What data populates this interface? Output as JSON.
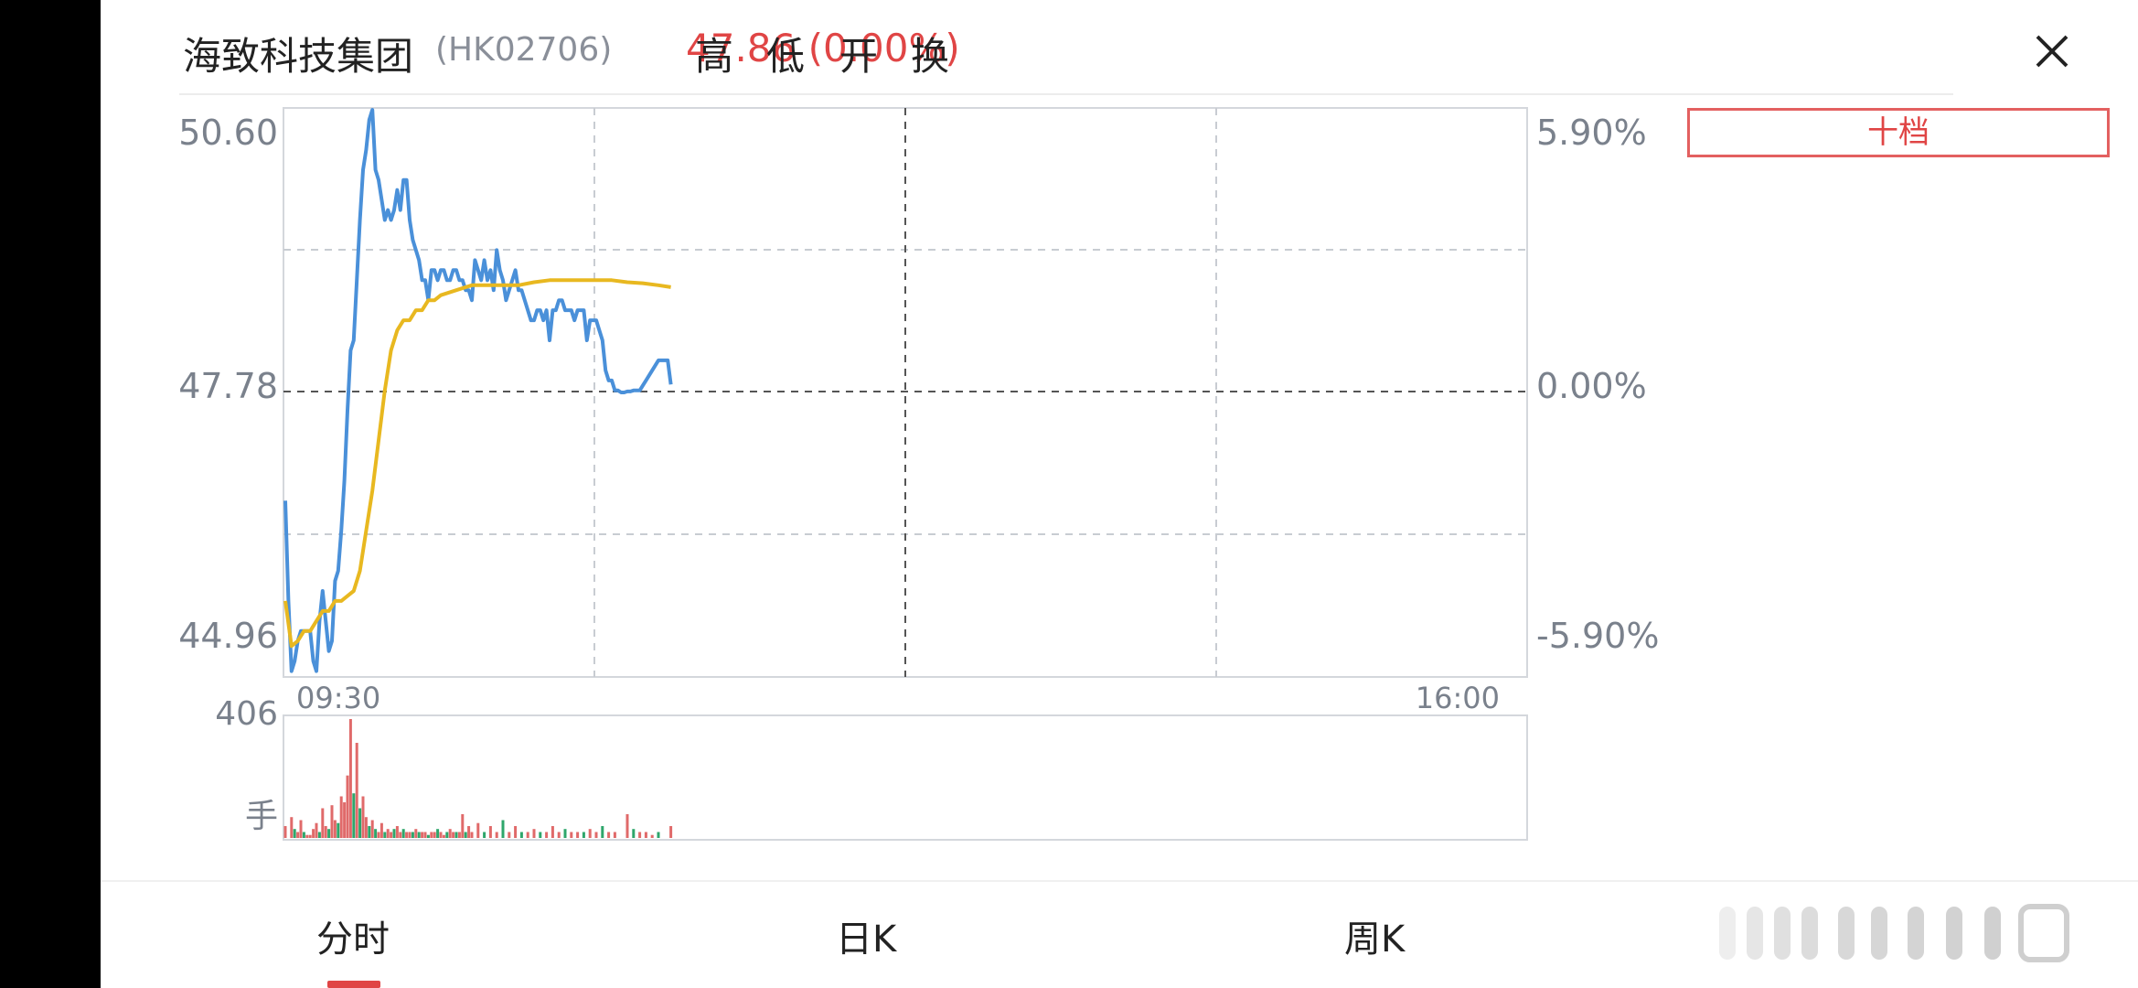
{
  "header": {
    "name": "海致科技集团",
    "code": "(HK02706)",
    "price_text": "47.86 (0.00%)",
    "buttons": [
      "高",
      "低",
      "开",
      "换"
    ]
  },
  "ten_level_label": "十档",
  "chart_data": {
    "type": "line",
    "title": "",
    "price_axis": {
      "min": 44.96,
      "mid": 47.78,
      "max": 50.6,
      "labels": [
        "50.60",
        "47.78",
        "44.96"
      ]
    },
    "pct_axis": {
      "labels": [
        "5.90%",
        "0.00%",
        "-5.90%"
      ]
    },
    "time_labels": [
      "09:30",
      "16:00"
    ],
    "volume_axis": {
      "max_label": "406",
      "unit_label": "手"
    },
    "series": [
      {
        "color": "#4a90d9",
        "x": [
          0,
          1,
          2,
          3,
          4,
          5,
          6,
          7,
          8,
          9,
          10,
          11,
          12,
          13,
          14,
          15,
          16,
          17,
          18,
          19,
          20,
          21,
          22,
          23,
          24,
          25,
          26,
          27,
          28,
          29,
          30,
          31,
          32,
          33,
          34,
          35,
          36,
          37,
          38,
          39,
          40,
          41,
          42,
          43,
          44,
          45,
          46,
          47,
          48,
          49,
          50,
          51,
          52,
          53,
          54,
          55,
          56,
          57,
          58,
          59,
          60,
          61,
          62,
          63,
          64,
          65,
          66,
          67,
          68,
          69,
          70,
          71,
          72,
          73,
          74,
          75,
          76,
          77,
          78,
          79,
          80,
          81,
          82,
          83,
          84,
          85,
          86,
          87,
          88,
          89,
          90,
          91,
          92,
          93,
          94,
          95,
          96,
          97,
          98,
          99,
          100,
          101,
          102,
          103,
          104,
          105,
          106,
          107,
          108,
          109,
          110,
          111,
          112,
          113,
          114,
          115,
          116,
          117,
          118,
          119,
          120,
          121,
          122,
          123,
          124
        ],
        "values": [
          46.7,
          45.7,
          45.0,
          45.1,
          45.3,
          45.4,
          45.4,
          45.4,
          45.4,
          45.1,
          45.0,
          45.5,
          45.8,
          45.5,
          45.2,
          45.3,
          45.9,
          46.0,
          46.4,
          46.9,
          47.6,
          48.2,
          48.3,
          48.9,
          49.5,
          50.0,
          50.2,
          50.5,
          50.6,
          50.0,
          49.9,
          49.7,
          49.5,
          49.6,
          49.5,
          49.6,
          49.8,
          49.6,
          49.9,
          49.9,
          49.5,
          49.3,
          49.2,
          49.1,
          48.9,
          48.9,
          48.7,
          49.0,
          49.0,
          48.9,
          49.0,
          49.0,
          48.9,
          48.9,
          49.0,
          49.0,
          48.9,
          48.9,
          48.8,
          48.8,
          48.7,
          49.1,
          49.0,
          48.9,
          49.1,
          48.9,
          49.0,
          48.8,
          49.2,
          49.0,
          48.9,
          48.7,
          48.8,
          48.9,
          49.0,
          48.8,
          48.8,
          48.7,
          48.6,
          48.5,
          48.5,
          48.6,
          48.6,
          48.5,
          48.6,
          48.3,
          48.6,
          48.6,
          48.7,
          48.7,
          48.6,
          48.6,
          48.6,
          48.5,
          48.6,
          48.6,
          48.6,
          48.3,
          48.5,
          48.5,
          48.5,
          48.4,
          48.3,
          48.0,
          47.9,
          47.9,
          47.8,
          47.8,
          47.78,
          47.78,
          47.79,
          47.79,
          47.8,
          47.8,
          47.8,
          47.85,
          47.9,
          47.95,
          48.0,
          48.05,
          48.1,
          48.1,
          48.1,
          48.1,
          47.86
        ]
      },
      {
        "color": "#e8b820",
        "x": [
          0,
          2,
          4,
          6,
          8,
          10,
          12,
          14,
          16,
          18,
          20,
          22,
          24,
          26,
          28,
          30,
          32,
          34,
          36,
          38,
          40,
          42,
          44,
          46,
          48,
          50,
          55,
          60,
          65,
          70,
          75,
          80,
          85,
          90,
          95,
          100,
          105,
          110,
          115,
          120,
          124
        ],
        "values": [
          45.7,
          45.25,
          45.3,
          45.4,
          45.4,
          45.5,
          45.6,
          45.6,
          45.7,
          45.7,
          45.75,
          45.8,
          46.0,
          46.4,
          46.8,
          47.3,
          47.8,
          48.2,
          48.4,
          48.5,
          48.5,
          48.6,
          48.6,
          48.7,
          48.7,
          48.75,
          48.8,
          48.85,
          48.85,
          48.85,
          48.85,
          48.88,
          48.9,
          48.9,
          48.9,
          48.9,
          48.9,
          48.88,
          48.87,
          48.85,
          48.83
        ]
      }
    ],
    "volume": {
      "x": [
        0,
        2,
        3,
        4,
        5,
        6,
        7,
        8,
        9,
        10,
        11,
        12,
        13,
        14,
        15,
        16,
        17,
        18,
        19,
        20,
        21,
        22,
        23,
        24,
        25,
        26,
        27,
        28,
        29,
        30,
        31,
        32,
        33,
        34,
        35,
        36,
        37,
        38,
        39,
        40,
        41,
        42,
        43,
        44,
        45,
        46,
        47,
        48,
        49,
        50,
        51,
        52,
        53,
        54,
        55,
        56,
        57,
        58,
        59,
        60,
        62,
        64,
        66,
        68,
        70,
        72,
        74,
        76,
        78,
        80,
        82,
        84,
        86,
        88,
        90,
        92,
        94,
        96,
        98,
        100,
        102,
        104,
        106,
        110,
        112,
        114,
        116,
        118,
        120,
        124
      ],
      "values": [
        40,
        70,
        30,
        20,
        60,
        20,
        10,
        10,
        30,
        50,
        20,
        100,
        40,
        30,
        110,
        60,
        50,
        140,
        120,
        210,
        400,
        150,
        320,
        100,
        140,
        70,
        40,
        60,
        30,
        20,
        50,
        20,
        30,
        20,
        30,
        40,
        20,
        30,
        20,
        20,
        20,
        30,
        20,
        20,
        20,
        10,
        20,
        20,
        30,
        20,
        10,
        20,
        30,
        20,
        20,
        20,
        80,
        20,
        40,
        20,
        50,
        20,
        40,
        20,
        60,
        20,
        40,
        20,
        20,
        30,
        20,
        20,
        40,
        20,
        30,
        20,
        20,
        20,
        30,
        20,
        40,
        20,
        20,
        80,
        30,
        20,
        20,
        10,
        20,
        40
      ],
      "up": [
        1,
        1,
        0,
        1,
        1,
        0,
        1,
        1,
        1,
        1,
        0,
        1,
        1,
        0,
        1,
        1,
        0,
        1,
        1,
        1,
        1,
        0,
        1,
        0,
        1,
        1,
        0,
        1,
        0,
        1,
        1,
        0,
        1,
        1,
        0,
        1,
        1,
        0,
        1,
        1,
        0,
        1,
        0,
        1,
        1,
        0,
        1,
        1,
        0,
        1,
        1,
        0,
        1,
        1,
        0,
        1,
        1,
        0,
        1,
        1,
        1,
        0,
        1,
        1,
        0,
        1,
        1,
        0,
        1,
        1,
        0,
        1,
        1,
        1,
        0,
        1,
        1,
        0,
        1,
        1,
        0,
        1,
        1,
        1,
        0,
        1,
        1,
        1,
        0,
        1
      ]
    }
  },
  "tabs": [
    "分时",
    "日K",
    "周K"
  ]
}
